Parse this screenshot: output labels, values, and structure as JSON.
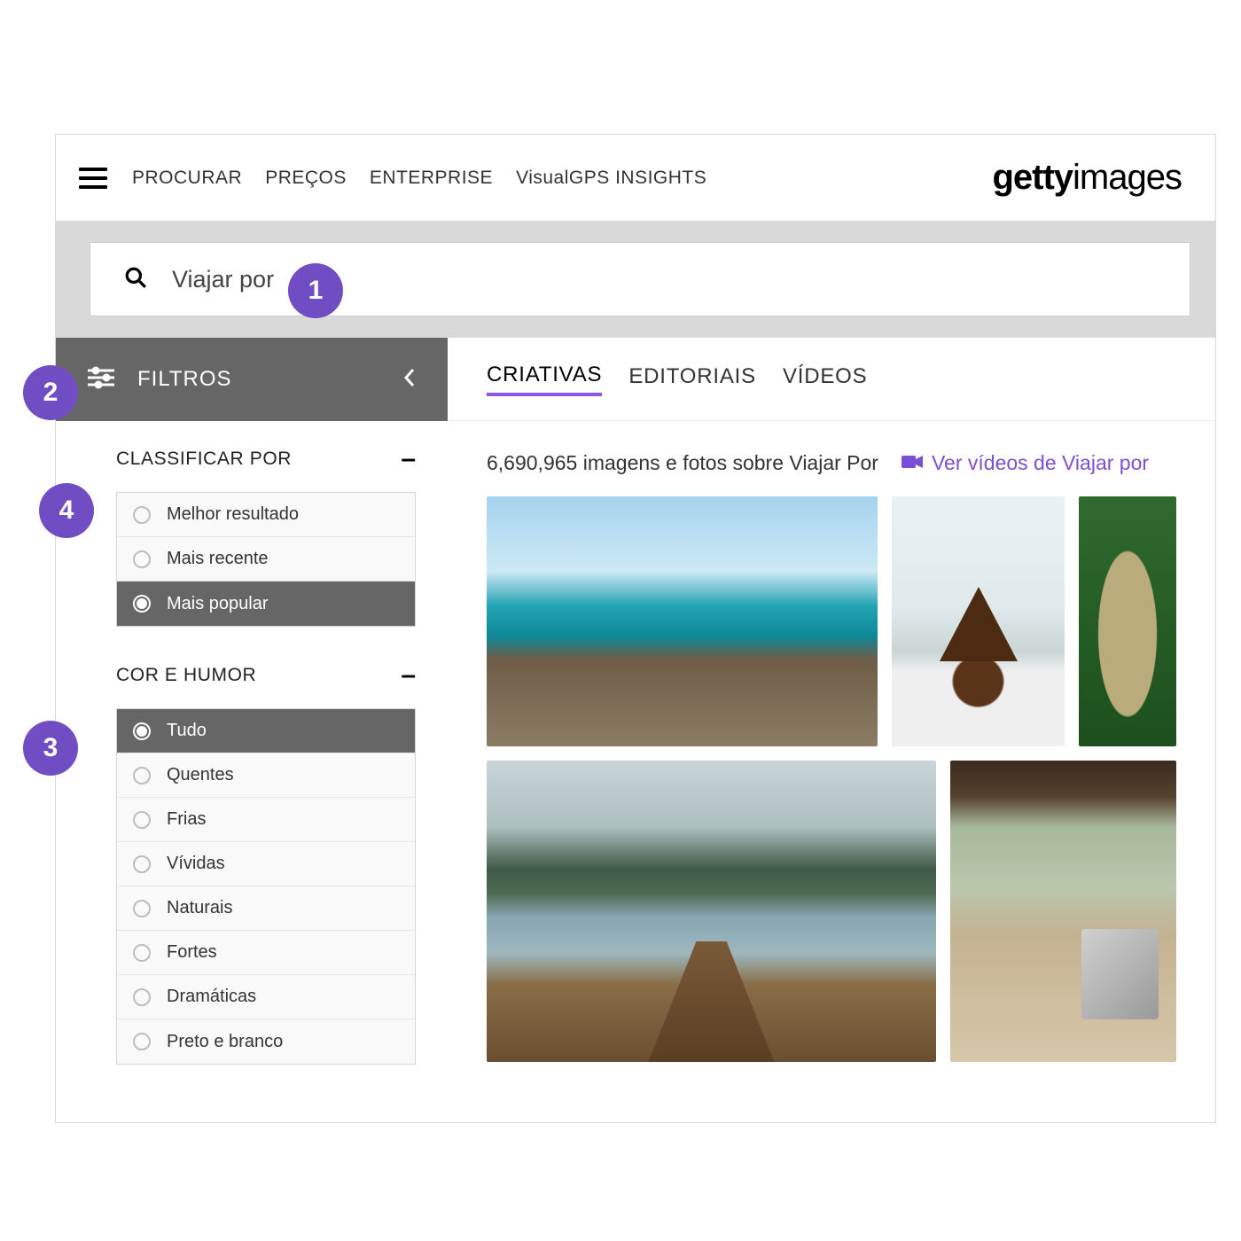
{
  "header": {
    "nav": [
      "PROCURAR",
      "PREÇOS",
      "ENTERPRISE",
      "VisualGPS INSIGHTS"
    ],
    "logo_bold": "getty",
    "logo_thin": "images"
  },
  "search": {
    "value": "Viajar por"
  },
  "filters": {
    "title": "FILTROS",
    "sections": [
      {
        "title": "CLASSIFICAR POR",
        "options": [
          "Melhor resultado",
          "Mais recente",
          "Mais popular"
        ],
        "selected": 2
      },
      {
        "title": "COR E HUMOR",
        "options": [
          "Tudo",
          "Quentes",
          "Frias",
          "Vívidas",
          "Naturais",
          "Fortes",
          "Dramáticas",
          "Preto e branco"
        ],
        "selected": 0
      }
    ]
  },
  "tabs": [
    "CRIATIVAS",
    "EDITORIAIS",
    "VÍDEOS"
  ],
  "active_tab": 0,
  "results": {
    "count_text": "6,690,965 imagens e fotos sobre Viajar Por",
    "video_link": "Ver vídeos de Viajar por"
  },
  "badges": [
    "1",
    "2",
    "3",
    "4"
  ],
  "colors": {
    "accent": "#714dc3"
  }
}
